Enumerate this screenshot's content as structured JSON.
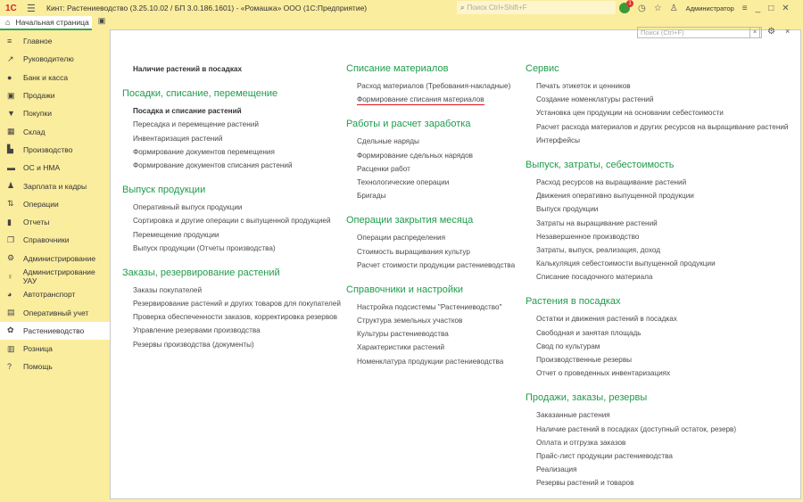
{
  "titlebar": {
    "logo": "1С",
    "title": "Кинт: Растениеводство (3.25.10.02 / БП 3.0.186.1601) - «Ромашка» ООО  (1С:Предприятие)",
    "search_placeholder": "Поиск Ctrl+Shift+F",
    "notifications": "1",
    "user": "Администратор"
  },
  "tabs": {
    "home": "Начальная страница"
  },
  "sidebar": {
    "items": [
      {
        "label": "Главное",
        "icon": "≡"
      },
      {
        "label": "Руководителю",
        "icon": "↗"
      },
      {
        "label": "Банк и касса",
        "icon": "●"
      },
      {
        "label": "Продажи",
        "icon": "▣"
      },
      {
        "label": "Покупки",
        "icon": "▼"
      },
      {
        "label": "Склад",
        "icon": "▦"
      },
      {
        "label": "Производство",
        "icon": "▙"
      },
      {
        "label": "ОС и НМА",
        "icon": "▬"
      },
      {
        "label": "Зарплата и кадры",
        "icon": "♟"
      },
      {
        "label": "Операции",
        "icon": "⇅"
      },
      {
        "label": "Отчеты",
        "icon": "▮"
      },
      {
        "label": "Справочники",
        "icon": "❐"
      },
      {
        "label": "Администрирование",
        "icon": "⚙"
      },
      {
        "label": "Администрирование УАУ",
        "icon": "♀"
      },
      {
        "label": "Автотранспорт",
        "icon": "◕"
      },
      {
        "label": "Оперативный учет",
        "icon": "▤"
      },
      {
        "label": "Растениеводство",
        "icon": "✿",
        "active": true
      },
      {
        "label": "Розница",
        "icon": "▥"
      },
      {
        "label": "Помощь",
        "icon": "?"
      }
    ]
  },
  "content": {
    "search_placeholder": "Поиск (Ctrl+F)",
    "clear": "×",
    "close": "×",
    "columns": [
      [
        {
          "items": [
            {
              "label": "Наличие растений в посадках",
              "bold": true
            }
          ]
        },
        {
          "heading": "Посадки, списание, перемещение",
          "items": [
            {
              "label": "Посадка и списание растений",
              "bold": true
            },
            {
              "label": "Пересадка и перемещение растений"
            },
            {
              "label": "Инвентаризация растений"
            },
            {
              "label": "Формирование документов перемещения"
            },
            {
              "label": "Формирование документов списания растений"
            }
          ]
        },
        {
          "heading": "Выпуск продукции",
          "items": [
            {
              "label": "Оперативный выпуск продукции"
            },
            {
              "label": "Сортировка и другие операции с выпущенной продукцией"
            },
            {
              "label": "Перемещение продукции"
            },
            {
              "label": "Выпуск продукции (Отчеты производства)"
            }
          ]
        },
        {
          "heading": "Заказы, резервирование растений",
          "items": [
            {
              "label": "Заказы покупателей"
            },
            {
              "label": "Резервирование растений и других товаров для покупателей"
            },
            {
              "label": "Проверка обеспеченности заказов, корректировка резервов"
            },
            {
              "label": "Управление резервами производства"
            },
            {
              "label": "Резервы производства (документы)"
            }
          ]
        }
      ],
      [
        {
          "heading": "Списание материалов",
          "items": [
            {
              "label": "Расход материалов (Требования-накладные)"
            },
            {
              "label": "Формирование списания материалов",
              "highlight": true
            }
          ]
        },
        {
          "heading": "Работы и расчет заработка",
          "items": [
            {
              "label": "Сдельные наряды"
            },
            {
              "label": "Формирование сдельных нарядов"
            },
            {
              "label": "Расценки работ"
            },
            {
              "label": "Технологические операции"
            },
            {
              "label": "Бригады"
            }
          ]
        },
        {
          "heading": "Операции закрытия месяца",
          "items": [
            {
              "label": "Операции распределения"
            },
            {
              "label": "Стоимость выращивания культур"
            },
            {
              "label": "Расчет стоимости продукции растениеводства"
            }
          ]
        },
        {
          "heading": "Справочники и настройки",
          "items": [
            {
              "label": "Настройка подсистемы \"Растениеводство\""
            },
            {
              "label": "Структура земельных участков"
            },
            {
              "label": "Культуры растениеводства"
            },
            {
              "label": "Характеристики растений"
            },
            {
              "label": "Номенклатура продукции растениеводства"
            }
          ]
        }
      ],
      [
        {
          "heading": "Сервис",
          "items": [
            {
              "label": "Печать этикеток и ценников"
            },
            {
              "label": "Создание номенклатуры растений"
            },
            {
              "label": "Установка цен продукции на основании себестоимости"
            },
            {
              "label": "Расчет расхода материалов и других ресурсов на выращивание растений"
            },
            {
              "label": "Интерфейсы"
            }
          ]
        },
        {
          "heading": "Выпуск, затраты, себестоимость",
          "items": [
            {
              "label": "Расход ресурсов на выращивание растений"
            },
            {
              "label": "Движения оперативно выпущенной продукции"
            },
            {
              "label": "Выпуск продукции"
            },
            {
              "label": "Затраты на выращивание растений"
            },
            {
              "label": "Незавершенное производство"
            },
            {
              "label": "Затраты, выпуск, реализация, доход"
            },
            {
              "label": "Калькуляция себестоимости выпущенной продукции"
            },
            {
              "label": "Списание посадочного материала"
            }
          ]
        },
        {
          "heading": "Растения в посадках",
          "items": [
            {
              "label": "Остатки и движения растений в посадках"
            },
            {
              "label": "Свободная и занятая площадь"
            },
            {
              "label": "Свод по культурам"
            },
            {
              "label": "Производственные резервы"
            },
            {
              "label": "Отчет о проведенных инвентаризациях"
            }
          ]
        },
        {
          "heading": "Продажи, заказы, резервы",
          "items": [
            {
              "label": "Заказанные растения"
            },
            {
              "label": "Наличие растений в посадках (доступный остаток, резерв)"
            },
            {
              "label": "Оплата и отгрузка заказов"
            },
            {
              "label": "Прайс-лист продукции растениеводства"
            },
            {
              "label": "Реализация"
            },
            {
              "label": "Резервы растений и товаров"
            }
          ]
        }
      ]
    ]
  }
}
